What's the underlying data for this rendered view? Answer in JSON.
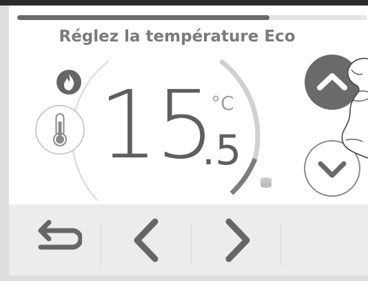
{
  "progress": {
    "value": 0.72
  },
  "title": "Réglez la température Eco",
  "temperature": {
    "integer": "15",
    "decimal": ".5",
    "unit": "°C"
  },
  "icons": {
    "flame": "flame-icon",
    "thermometer": "thermometer-icon",
    "stack": "coin-stack-icon",
    "up": "chevron-up-icon",
    "down": "chevron-down-icon",
    "back": "back-arrow-icon",
    "prev": "chevron-left-icon",
    "next": "chevron-right-icon"
  },
  "colors": {
    "accent_dark": "#666666",
    "text": "#5f5f5f",
    "title": "#7a7a7a",
    "bottom_bar": "#ececec"
  }
}
